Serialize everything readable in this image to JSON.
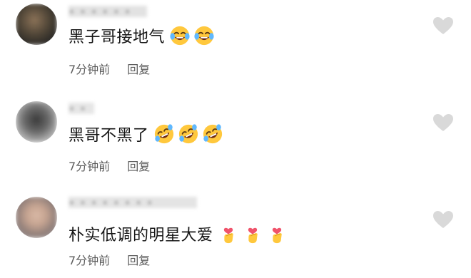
{
  "comments": [
    {
      "username": "• • • • • •",
      "text": "黑子哥接地气",
      "emojis": [
        "tears-of-joy-emoji",
        "tears-of-joy-emoji"
      ],
      "time": "7分钟前",
      "reply_label": "回复"
    },
    {
      "username": "• •",
      "text": "黑哥不黑了",
      "emojis": [
        "rolling-laughing-emoji",
        "rolling-laughing-emoji",
        "rolling-laughing-emoji"
      ],
      "time": "7分钟前",
      "reply_label": "回复"
    },
    {
      "username": "• • • • • • • •",
      "text": "朴实低调的明星大爱",
      "emojis": [
        "finger-heart-emoji",
        "finger-heart-emoji",
        "finger-heart-emoji"
      ],
      "time": "7分钟前",
      "reply_label": "回复"
    }
  ],
  "colors": {
    "text": "#161616",
    "meta": "#5c5c5c",
    "like_icon": "#d9d9d9",
    "emoji_face": "#ffc83d"
  },
  "icons": {
    "like": "heart-icon"
  }
}
